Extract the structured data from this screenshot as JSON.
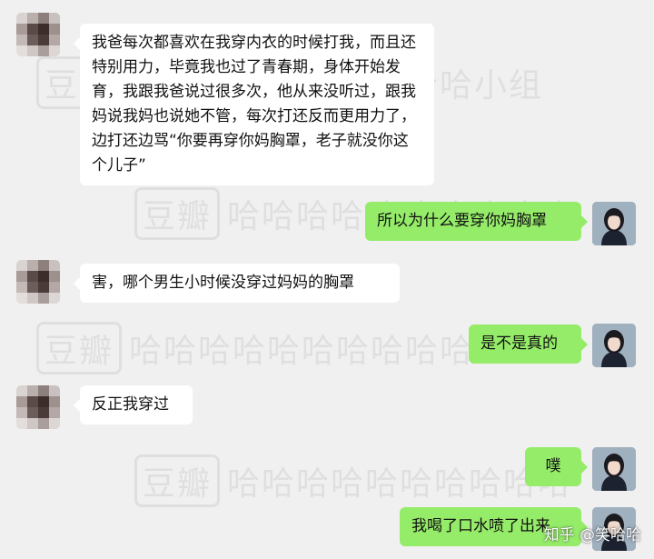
{
  "watermark": {
    "brand": "豆瓣",
    "group_text": "哈哈哈哈哈哈哈哈哈哈小组",
    "row_text": "哈哈哈哈哈哈哈哈哈哈"
  },
  "messages": [
    {
      "side": "left",
      "text": "我爸每次都喜欢在我穿内衣的时候打我，而且还特别用力，毕竟我也过了青春期，身体开始发育，我跟我爸说过很多次，他从来没听过，跟我妈说我妈也说她不管，每次打还反而更用力了，边打还边骂“你要再穿你妈胸罩，老子就没你这个儿子”"
    },
    {
      "side": "right",
      "text": "所以为什么要穿你妈胸罩"
    },
    {
      "side": "left",
      "text": "害，哪个男生小时候没穿过妈妈的胸罩"
    },
    {
      "side": "right",
      "text": "是不是真的"
    },
    {
      "side": "left",
      "text": "反正我穿过"
    },
    {
      "side": "right",
      "text": "噗"
    },
    {
      "side": "right",
      "text": "我喝了口水喷了出来"
    }
  ],
  "credit": "知乎 @笑哈哈",
  "colors": {
    "background": "#f0f0f0",
    "left_bubble": "#ffffff",
    "right_bubble": "#95ec69"
  },
  "icons": {
    "left_avatar": "pixelated-avatar-icon",
    "right_avatar": "girl-photo-avatar-icon"
  }
}
